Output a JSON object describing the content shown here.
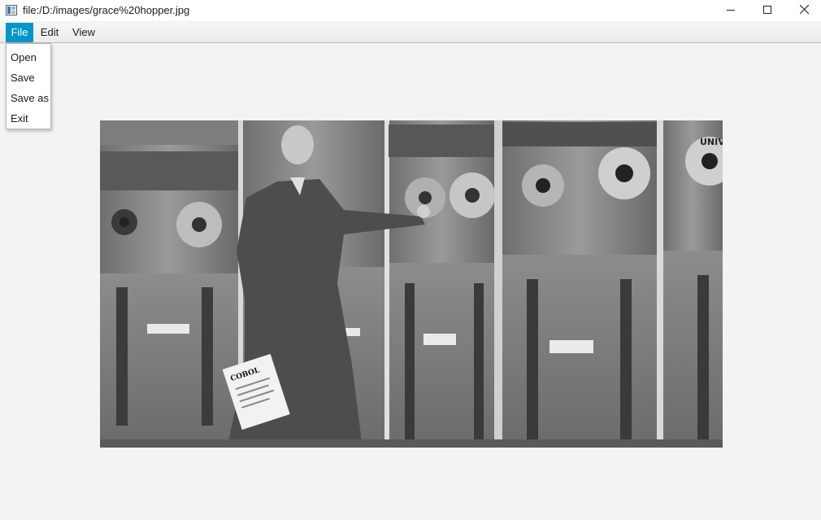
{
  "window": {
    "title": "file:/D:/images/grace%20hopper.jpg",
    "controls": [
      "minimize-icon",
      "maximize-icon",
      "close-icon"
    ]
  },
  "menubar": {
    "file_label": "File",
    "edit_label": "Edit",
    "view_label": "View",
    "active": "File",
    "active_color": "#0096c9"
  },
  "file_menu": {
    "items": [
      "Open",
      "Save",
      "Save as",
      "Exit"
    ]
  },
  "photo": {
    "alt": "Black-and-white photograph of Grace Hopper standing beside UNIVAC tape drives, holding a COBOL manual",
    "booklet_title": "COBOL",
    "machine_brand": "UNIVAC"
  }
}
